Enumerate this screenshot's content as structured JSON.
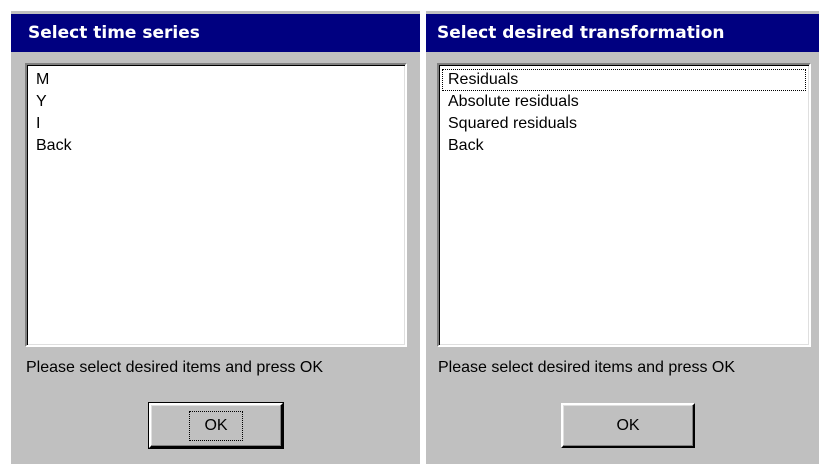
{
  "left_dialog": {
    "title": "Select time series",
    "list_items": [
      "M",
      "Y",
      "I",
      "Back"
    ],
    "hint": "Please select desired items and press OK",
    "ok_label": "OK"
  },
  "right_dialog": {
    "title": "Select desired transformation",
    "list_items": [
      "Residuals",
      "Absolute residuals",
      "Squared residuals",
      "Back"
    ],
    "hint": "Please select desired items and press OK",
    "ok_label": "OK"
  },
  "colors": {
    "titlebar": "#000080",
    "dialog_face": "#c0c0c0",
    "list_background": "#ffffff"
  }
}
